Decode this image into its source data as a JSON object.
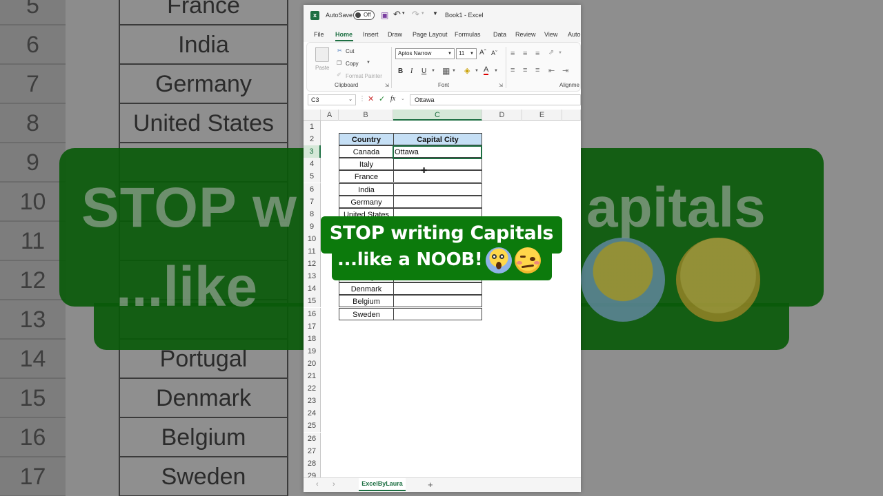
{
  "background_zoom": {
    "row_numbers": [
      "5",
      "6",
      "7",
      "8",
      "9",
      "10",
      "11",
      "12",
      "13",
      "14",
      "15",
      "16",
      "17"
    ],
    "cells": [
      "France",
      "India",
      "Germany",
      "United States",
      "",
      "",
      "",
      "",
      "",
      "Portugal",
      "Denmark",
      "Belgium",
      "Sweden"
    ],
    "overlay_line1_left": "STOP w",
    "overlay_line1_right": "apitals",
    "overlay_line2": "...like"
  },
  "window": {
    "autosave_label": "AutoSave",
    "autosave_state": "Off",
    "book_title": "Book1 - Excel",
    "menu": [
      "File",
      "Home",
      "Insert",
      "Draw",
      "Page Layout",
      "Formulas",
      "Data",
      "Review",
      "View",
      "Auto"
    ],
    "ribbon": {
      "paste": "Paste",
      "cut": "Cut",
      "copy": "Copy",
      "format_painter": "Format Painter",
      "clipboard_group": "Clipboard",
      "font_name": "Aptos Narrow",
      "font_size": "11",
      "font_group": "Font",
      "alignment_group": "Alignme",
      "bold": "B",
      "italic": "I",
      "underline": "U"
    },
    "formula_bar": {
      "name_box": "C3",
      "fx": "fx",
      "content": "Ottawa"
    },
    "columns": [
      "A",
      "B",
      "C",
      "D",
      "E"
    ],
    "rows": [
      "1",
      "2",
      "3",
      "4",
      "5",
      "6",
      "7",
      "8",
      "9",
      "10",
      "11",
      "12",
      "13",
      "14",
      "15",
      "16",
      "17",
      "18",
      "19",
      "20",
      "21",
      "22",
      "23",
      "24",
      "25",
      "26",
      "27",
      "28",
      "29"
    ],
    "table": {
      "header_country": "Country",
      "header_capital": "Capital City",
      "countries": [
        "Canada",
        "Italy",
        "France",
        "India",
        "Germany",
        "United States",
        "",
        "",
        "",
        "",
        "Portugal",
        "Denmark",
        "Belgium",
        "Sweden"
      ],
      "capitals": [
        "Ottawa",
        "",
        "",
        "",
        "",
        "",
        "",
        "",
        "",
        "",
        "",
        "",
        "",
        ""
      ]
    },
    "sheet_tab": "ExcelByLaura",
    "add_sheet": "+"
  },
  "overlay": {
    "line1": "STOP writing Capitals",
    "line2": "...like a NOOB!",
    "emojis": [
      "face-screaming-in-fear",
      "woozy-face"
    ],
    "color": "#0c7a0c"
  },
  "colors": {
    "excel_green": "#1d6f42",
    "table_header": "#c5dff5"
  }
}
